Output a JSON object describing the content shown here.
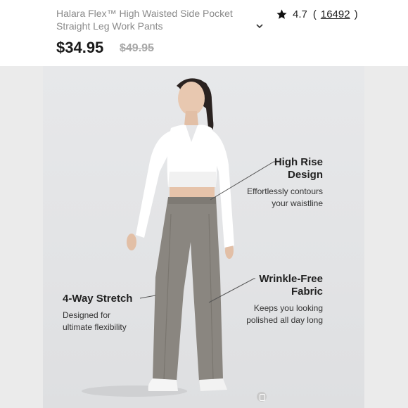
{
  "product": {
    "title": "Halara Flex™ High Waisted Side Pocket Straight Leg Work Pants",
    "title_line1": "Halara Flex™ High Waisted Side Pocket",
    "title_line2": "Straight Leg Work Pants",
    "price": "$34.95",
    "original_price": "$49.95",
    "rating": "4.7",
    "review_count": "16492",
    "paren_open": "(",
    "paren_close": ")"
  },
  "icons": {
    "rating": "star-icon",
    "expand": "chevron-down-icon",
    "image_indicator": "image-dot-icon"
  },
  "callouts": {
    "high_rise": {
      "heading_line1": "High Rise",
      "heading_line2": "Design",
      "desc_line1": "Effortlessly contours",
      "desc_line2": "your waistline"
    },
    "wrinkle_free": {
      "heading_line1": "Wrinkle-Free",
      "heading_line2": "Fabric",
      "desc_line1": "Keeps you looking",
      "desc_line2": "polished all day long"
    },
    "stretch": {
      "heading_line1": "4-Way Stretch",
      "desc_line1": "Designed for",
      "desc_line2": "ultimate flexibility"
    }
  },
  "colors": {
    "price": "#1a1a1a",
    "old_price": "#a8a8a8",
    "background": "#e4e5e7",
    "top": "#ffffff",
    "pants": "#8a8680"
  }
}
